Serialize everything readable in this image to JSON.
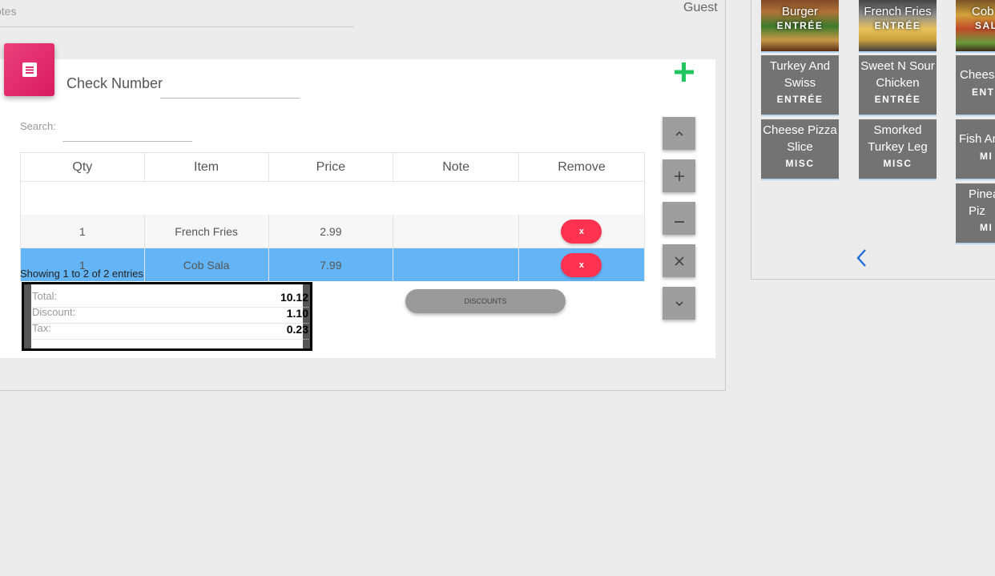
{
  "header": {
    "notes_label": "otes",
    "guest_label": "Guest"
  },
  "check": {
    "label": "Check Number",
    "value": ""
  },
  "search": {
    "label": "Search:",
    "value": ""
  },
  "table": {
    "columns": [
      "Qty",
      "Item",
      "Price",
      "Note",
      "Remove"
    ],
    "rows": [
      {
        "qty": "1",
        "item": "French Fries",
        "price": "2.99",
        "note": "",
        "remove": "x",
        "selected": false
      },
      {
        "qty": "1",
        "item": "Cob Sala",
        "price": "7.99",
        "note": "",
        "remove": "x",
        "selected": true
      }
    ],
    "showing": "Showing 1 to 2 of 2 entries"
  },
  "totals": {
    "total_label": "Total:",
    "total_value": "10.12",
    "discount_label": "Discount:",
    "discount_value": "1.10",
    "tax_label": "Tax:",
    "tax_value": "0.23"
  },
  "discounts_button": "DISCOUNTS",
  "side_controls": [
    {
      "name": "scroll-up-button",
      "glyph": "⌃",
      "icon": "chevron-up-icon"
    },
    {
      "name": "increase-qty-button",
      "glyph": "+",
      "icon": "plus-icon"
    },
    {
      "name": "decrease-qty-button",
      "glyph": "−",
      "icon": "minus-icon"
    },
    {
      "name": "delete-item-button",
      "glyph": "✕",
      "icon": "close-icon"
    },
    {
      "name": "scroll-down-button",
      "glyph": "⌄",
      "icon": "chevron-down-icon"
    }
  ],
  "menu_items": [
    {
      "name": "Burger",
      "category": "ENTRÉE"
    },
    {
      "name": "French Fries",
      "category": "ENTRÉE"
    },
    {
      "name": "Cob",
      "category": "SAL"
    },
    {
      "name": "Turkey And Swiss",
      "category": "ENTRÉE"
    },
    {
      "name": "Sweet N Sour Chicken",
      "category": "ENTRÉE"
    },
    {
      "name": "Cheese",
      "category": "ENT"
    },
    {
      "name": "Cheese Pizza Slice",
      "category": "MISC"
    },
    {
      "name": "Smorked Turkey Leg",
      "category": "MISC"
    },
    {
      "name": "Fish An",
      "category": "MI"
    },
    {
      "name": "Pinea Piz",
      "category": "MI"
    }
  ],
  "colors": {
    "accent_pink": "#e91e63",
    "add_green": "#22c55e",
    "selected_row": "#64b5f6",
    "remove_red": "#ff3350",
    "nav_blue": "#1e6fd9"
  }
}
